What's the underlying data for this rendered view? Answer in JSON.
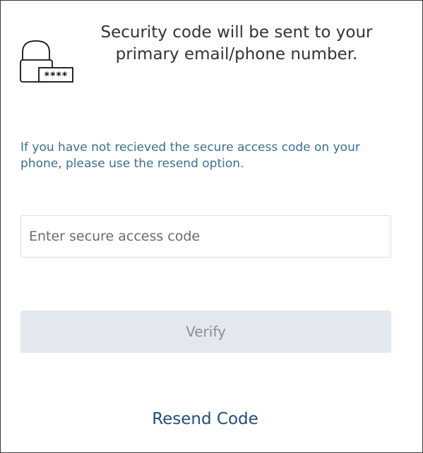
{
  "header": {
    "message": "Security code will be sent to your  primary email/phone number.",
    "icon": "lock-with-password-icon",
    "icon_mask_text": "****"
  },
  "info": {
    "message": "If you have not recieved the secure access code on your phone, please use the resend option."
  },
  "code_input": {
    "placeholder": "Enter secure access code",
    "value": ""
  },
  "verify_button": {
    "label": "Verify"
  },
  "resend": {
    "label": "Resend Code"
  },
  "colors": {
    "info_text": "#3a6f93",
    "link": "#1f4e7a",
    "button_bg": "#e3e8ef",
    "button_text": "#8a8f96"
  }
}
